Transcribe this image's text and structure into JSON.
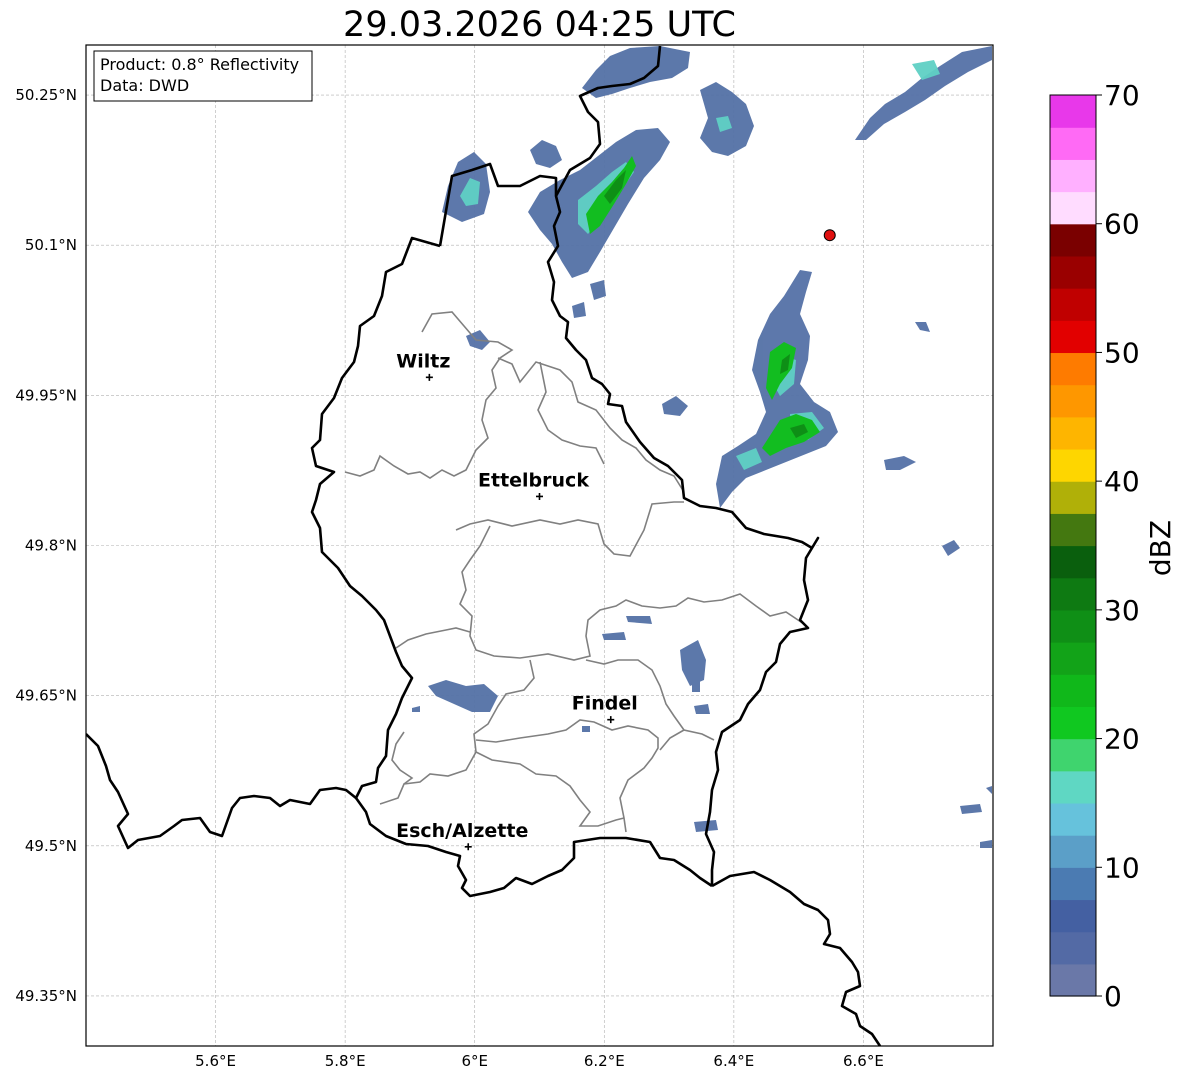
{
  "title": "29.03.2026 04:25 UTC",
  "info_box": {
    "line1": "Product: 0.8° Reflectivity",
    "line2": "Data: DWD"
  },
  "map": {
    "lon_range": [
      5.4,
      6.8
    ],
    "lat_range": [
      49.3,
      50.3
    ],
    "lon_ticks": [
      {
        "value": 5.6,
        "label": "5.6°E"
      },
      {
        "value": 5.8,
        "label": "5.8°E"
      },
      {
        "value": 6.0,
        "label": "6°E"
      },
      {
        "value": 6.2,
        "label": "6.2°E"
      },
      {
        "value": 6.4,
        "label": "6.4°E"
      },
      {
        "value": 6.6,
        "label": "6.6°E"
      }
    ],
    "lat_ticks": [
      {
        "value": 49.35,
        "label": "49.35°N"
      },
      {
        "value": 49.5,
        "label": "49.5°N"
      },
      {
        "value": 49.65,
        "label": "49.65°N"
      },
      {
        "value": 49.8,
        "label": "49.8°N"
      },
      {
        "value": 49.95,
        "label": "49.95°N"
      },
      {
        "value": 50.1,
        "label": "50.1°N"
      },
      {
        "value": 50.25,
        "label": "50.25°N"
      }
    ],
    "cities": [
      {
        "name": "Wiltz",
        "lon": 5.93,
        "lat": 49.968
      },
      {
        "name": "Ettelbruck",
        "lon": 6.1,
        "lat": 49.849
      },
      {
        "name": "Findel",
        "lon": 6.21,
        "lat": 49.626
      },
      {
        "name": "Esch/Alzette",
        "lon": 5.99,
        "lat": 49.499
      }
    ],
    "radar_site": {
      "lon": 6.548,
      "lat": 50.11,
      "color": "#e01010"
    },
    "border_color": "#000000",
    "canton_color": "#808080"
  },
  "colorbar": {
    "label": "dBZ",
    "min": 0,
    "max": 70,
    "ticks": [
      0,
      10,
      20,
      30,
      40,
      50,
      60,
      70
    ],
    "colors": [
      "#6a78a8",
      "#536aa5",
      "#4460a2",
      "#4b7bb2",
      "#5b9fc8",
      "#66c2dc",
      "#5fd7c3",
      "#3fd46e",
      "#10c820",
      "#10b81a",
      "#12a318",
      "#0f8f16",
      "#0e7a12",
      "#0a5f0d",
      "#447810",
      "#b0b008",
      "#fed600",
      "#feb500",
      "#fe9700",
      "#fe7b00",
      "#e20000",
      "#c00000",
      "#9a0000",
      "#7a0000",
      "#ffdcff",
      "#ffb0ff",
      "#ff6af5",
      "#e838ea"
    ]
  }
}
